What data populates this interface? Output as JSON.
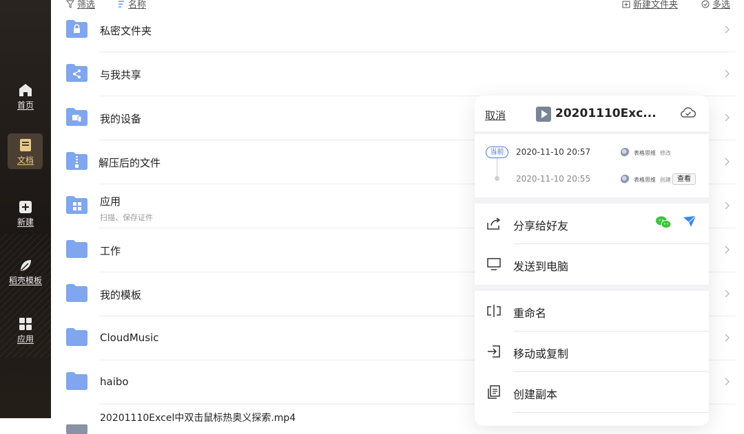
{
  "sidebar": {
    "items": [
      {
        "label": "首页",
        "icon": "home-icon"
      },
      {
        "label": "文档",
        "icon": "document-icon",
        "active": true
      },
      {
        "label": "新建",
        "icon": "plus-square-icon"
      },
      {
        "label": "稻壳模板",
        "icon": "leaf-icon"
      },
      {
        "label": "应用",
        "icon": "grid-icon"
      }
    ]
  },
  "toolbar": {
    "filter_label": "筛选",
    "sort_label": "名称",
    "new_folder_label": "新建文件夹",
    "multi_select_label": "多选"
  },
  "files": [
    {
      "name": "私密文件夹",
      "icon": "lock-folder-icon"
    },
    {
      "name": "与我共享",
      "icon": "share-folder-icon"
    },
    {
      "name": "我的设备",
      "icon": "device-folder-icon"
    },
    {
      "name": "解压后的文件",
      "icon": "zip-folder-icon"
    },
    {
      "name": "应用",
      "sub": "扫描、保存证件",
      "icon": "apps-folder-icon"
    },
    {
      "name": "工作",
      "icon": "folder-icon"
    },
    {
      "name": "我的模板",
      "icon": "folder-icon"
    },
    {
      "name": "CloudMusic",
      "icon": "folder-icon"
    },
    {
      "name": "haibo",
      "icon": "folder-icon"
    },
    {
      "name": "20201110Excel中双击鼠标热奥义探索.mp4",
      "icon": "video-file-icon"
    }
  ],
  "panel": {
    "cancel_label": "取消",
    "title": "20201110Exc...",
    "versions": [
      {
        "tag": "当前",
        "date": "2020-11-10 20:57",
        "user": "表格思维",
        "action": "修改"
      },
      {
        "date": "2020-11-10 20:55",
        "user": "表格思维",
        "action": "创建",
        "button": "查看"
      }
    ],
    "actions": [
      {
        "label": "分享给好友",
        "icon": "share-icon"
      },
      {
        "label": "发送到电脑",
        "icon": "monitor-icon"
      },
      {
        "label": "重命名",
        "icon": "rename-icon"
      },
      {
        "label": "移动或复制",
        "icon": "move-icon"
      },
      {
        "label": "创建副本",
        "icon": "copy-icon"
      }
    ]
  },
  "colors": {
    "sidebar_bg": "#1c1815",
    "sidebar_active": "#e9c98a",
    "folder": "#7fa6ee",
    "accent": "#4a7be0",
    "wechat": "#3cc23c"
  }
}
